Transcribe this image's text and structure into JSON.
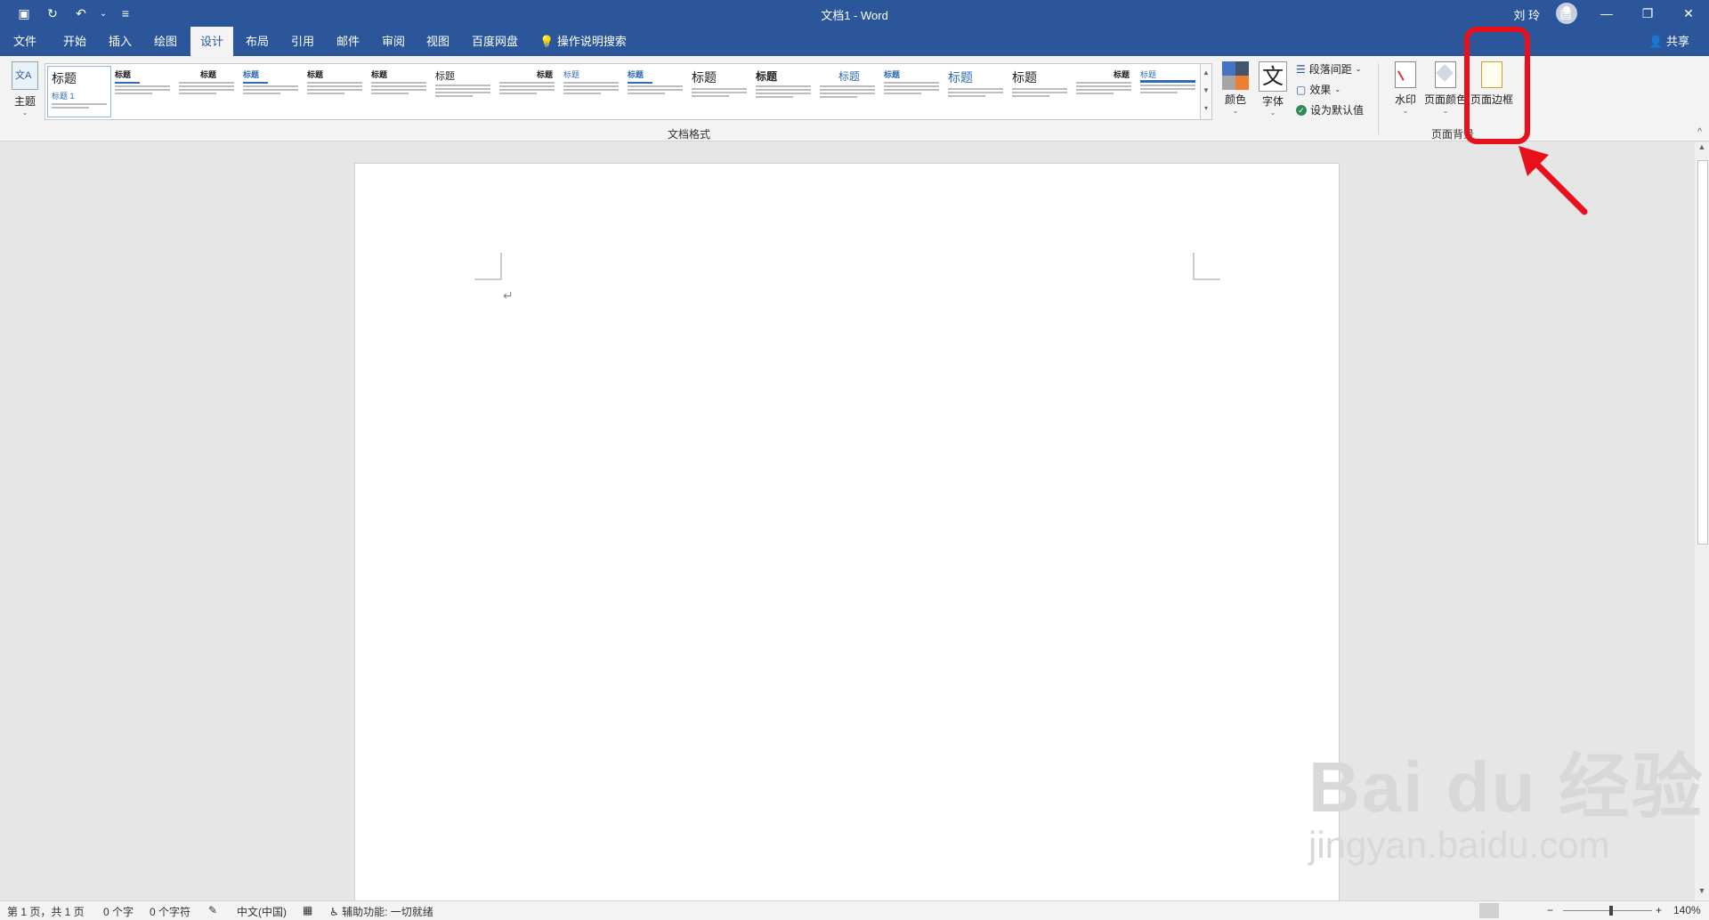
{
  "window": {
    "title": "文档1 - Word",
    "user_name": "刘 玲",
    "quick_access": [
      {
        "icon": "save-icon",
        "glyph": "▣"
      },
      {
        "icon": "autosave-icon",
        "glyph": "↻"
      },
      {
        "icon": "undo-icon",
        "glyph": "↶"
      },
      {
        "icon": "undo-dropdown-icon",
        "glyph": "⌄"
      },
      {
        "icon": "customize-qat-icon",
        "glyph": "≡"
      }
    ],
    "window_buttons": [
      {
        "name": "ribbon-display-button",
        "glyph": "▤"
      },
      {
        "name": "minimize-button",
        "glyph": "—"
      },
      {
        "name": "restore-button",
        "glyph": "❐"
      },
      {
        "name": "close-button",
        "glyph": "✕"
      }
    ]
  },
  "tabs": {
    "items": [
      "文件",
      "开始",
      "插入",
      "绘图",
      "设计",
      "布局",
      "引用",
      "邮件",
      "审阅",
      "视图",
      "百度网盘"
    ],
    "active": "设计",
    "tell_me": "操作说明搜索",
    "share": "共享"
  },
  "ribbon": {
    "themes_label": "主题",
    "gallery": {
      "label": "文档格式",
      "items": [
        {
          "title": "标题",
          "subtitle": "标题 1"
        },
        {
          "title": "标题"
        },
        {
          "title": "标题"
        },
        {
          "title": "标题"
        },
        {
          "title": "标题"
        },
        {
          "title": "标题"
        },
        {
          "title": "标题"
        },
        {
          "title": "标题"
        },
        {
          "title": "标题"
        },
        {
          "title": "标题"
        },
        {
          "title": "标题"
        },
        {
          "title": "标题"
        },
        {
          "title": "标题"
        },
        {
          "title": "标题"
        },
        {
          "title": "标题"
        },
        {
          "title": "标题"
        },
        {
          "title": "标题"
        },
        {
          "title": "标题"
        }
      ]
    },
    "colors_label": "颜色",
    "fonts_label": "字体",
    "paragraph_spacing": "段落间距",
    "effects": "效果",
    "set_default": "设为默认值",
    "page_background": {
      "label": "页面背景",
      "watermark": "水印",
      "page_color": "页面颜色",
      "page_borders": "页面边框"
    },
    "accent_color": "#2b579a",
    "highlight_color": "#e8101b"
  },
  "document": {
    "paragraph_mark": "↵"
  },
  "status": {
    "page": "第 1 页，共 1 页",
    "words": "0 个字",
    "chars": "0 个字符",
    "language": "中文(中国)",
    "accessibility": "辅助功能: 一切就绪",
    "zoom": "140%",
    "zoom_minus": "−",
    "zoom_plus": "+"
  },
  "watermark": {
    "line1": "Bai du 经验",
    "line2": "jingyan.baidu.com"
  }
}
